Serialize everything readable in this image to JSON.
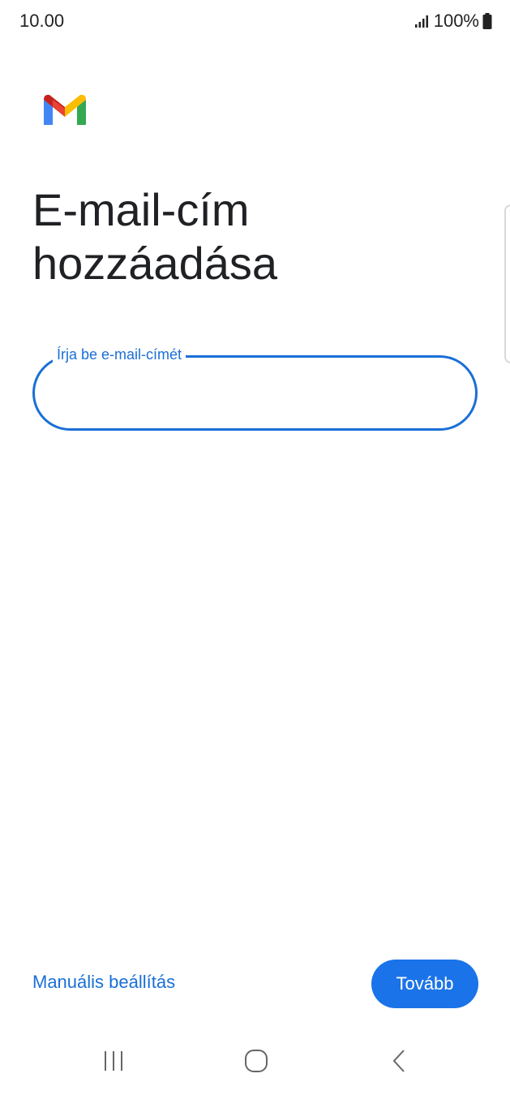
{
  "status_bar": {
    "time": "10.00",
    "battery_text": "100%",
    "icons": [
      "signal-icon",
      "battery-icon"
    ]
  },
  "app": {
    "logo_icon": "gmail-logo-icon",
    "colors": {
      "accent": "#1a73e8",
      "field_border": "#1a6fd6",
      "logo_red": "#ea4335",
      "logo_blue": "#4285f4",
      "logo_green": "#34a853",
      "logo_yellow": "#fbbc04",
      "logo_dark_red": "#c5221f"
    }
  },
  "main": {
    "title": "E-mail-cím\nhozzáadása",
    "email_field": {
      "label": "Írja be e-mail-címét",
      "value": "",
      "placeholder": ""
    }
  },
  "footer": {
    "manual_setup_label": "Manuális beállítás",
    "next_button_label": "Tovább"
  },
  "nav_bar": {
    "icons": [
      "recents-icon",
      "home-icon",
      "back-icon"
    ]
  }
}
